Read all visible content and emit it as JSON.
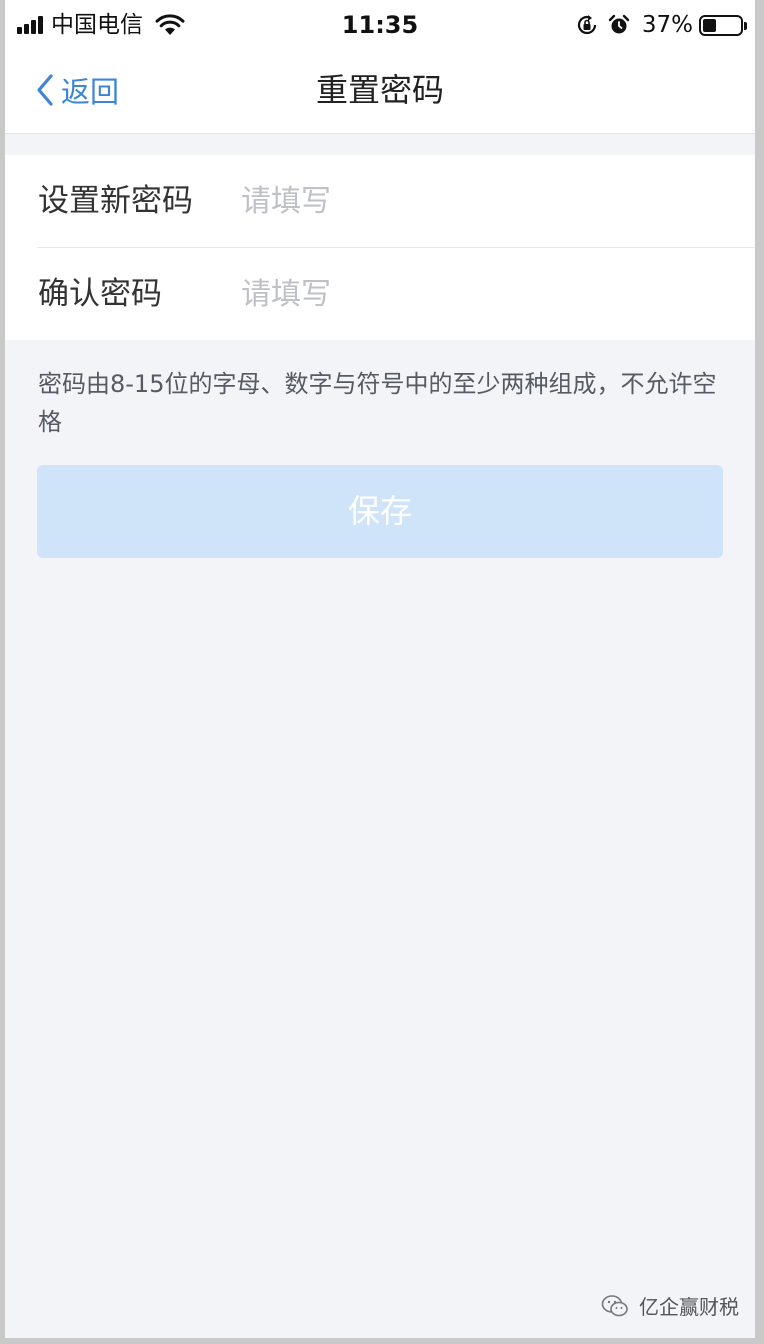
{
  "status_bar": {
    "carrier": "中国电信",
    "time": "11:35",
    "battery_percent": "37%",
    "battery_level": 0.37,
    "icons": [
      "signal-icon",
      "wifi-icon",
      "rotation-lock-icon",
      "alarm-icon",
      "battery-icon"
    ]
  },
  "nav": {
    "back_label": "返回",
    "title": "重置密码"
  },
  "form": {
    "new_password": {
      "label": "设置新密码",
      "placeholder": "请填写",
      "value": ""
    },
    "confirm_password": {
      "label": "确认密码",
      "placeholder": "请填写",
      "value": ""
    }
  },
  "hint": "密码由8-15位的字母、数字与符号中的至少两种组成，不允许空格",
  "save_button": {
    "label": "保存",
    "enabled": false
  },
  "watermark": {
    "text": "亿企赢财税",
    "icon": "wechat-icon"
  },
  "colors": {
    "accent": "#3d85d7",
    "page_background": "#f3f4f8",
    "button_disabled": "#cfe4f8",
    "placeholder": "#bfc1c6"
  }
}
